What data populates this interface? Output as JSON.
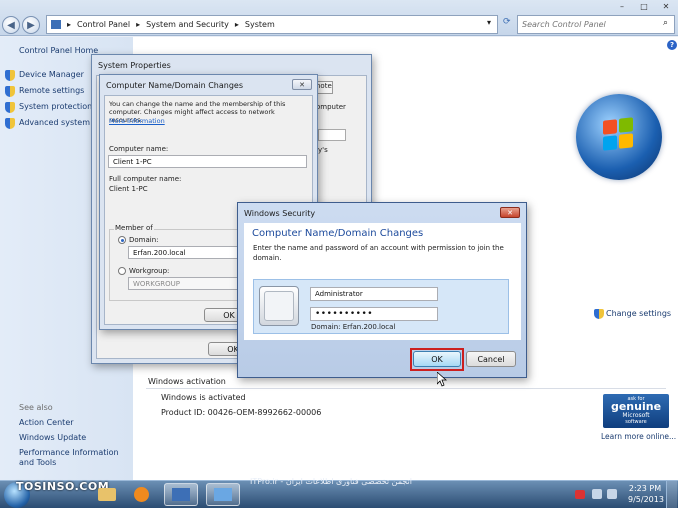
{
  "explorer": {
    "breadcrumb": [
      "Control Panel",
      "System and Security",
      "System"
    ],
    "search_placeholder": "Search Control Panel"
  },
  "sidebar": {
    "home": "Control Panel Home",
    "items": [
      {
        "label": "Device Manager",
        "icon": "shield-icon"
      },
      {
        "label": "Remote settings",
        "icon": "shield-icon"
      },
      {
        "label": "System protection",
        "icon": "shield-icon"
      },
      {
        "label": "Advanced system se",
        "icon": "shield-icon"
      }
    ],
    "see_also": "See also",
    "see_also_items": [
      "Action Center",
      "Windows Update",
      "Performance Information and Tools"
    ]
  },
  "main": {
    "computer_fragment": "omputer",
    "ys_fragment": "y's",
    "change_settings": "Change settings",
    "activation_heading": "Windows activation",
    "activated": "Windows is activated",
    "product_id": "Product ID: 00426-OEM-8992662-00006",
    "genuine_badge": {
      "top": "ask for",
      "main": "genuine",
      "sub": "Microsoft",
      "bottom": "software"
    },
    "learn_more": "Learn more online..."
  },
  "system_properties": {
    "title": "System Properties",
    "tab_fragment": "note",
    "ok": "OK"
  },
  "name_changes": {
    "title": "Computer Name/Domain Changes",
    "intro": "You can change the name and the membership of this computer. Changes might affect access to network resources.",
    "more_info": "More information",
    "computer_name_label": "Computer name:",
    "computer_name_value": "Client 1-PC",
    "full_name_label": "Full computer name:",
    "full_name_value": "Client 1-PC",
    "member_of": "Member of",
    "domain_label": "Domain:",
    "domain_value": "Erfan.200.local",
    "workgroup_label": "Workgroup:",
    "workgroup_value": "WORKGROUP",
    "ok": "OK"
  },
  "security": {
    "title": "Windows Security",
    "heading": "Computer Name/Domain Changes",
    "instruction": "Enter the name and password of an account with permission to join the domain.",
    "username": "Administrator",
    "password": "••••••••••",
    "domain_note": "Domain: Erfan.200.local",
    "ok": "OK",
    "cancel": "Cancel"
  },
  "watermarks": {
    "left": "TOSINSO.COM",
    "right": "ITPro.ir - انجمن تخصصی فناوری اطلاعات ایران"
  },
  "taskbar": {
    "time": "2:23 PM",
    "date": "9/5/2013"
  },
  "colors": {
    "link": "#1b3c70",
    "highlight": "#cc1e1e",
    "dialog_blue": "#1c4a9c"
  }
}
